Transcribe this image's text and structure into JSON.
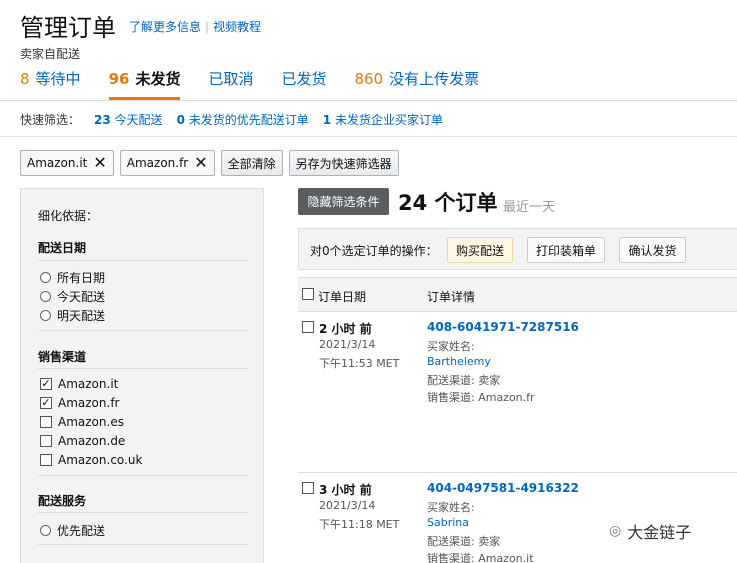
{
  "header": {
    "title": "管理订单",
    "link_learn": "了解更多信息",
    "link_video": "视频教程",
    "subtitle": "卖家自配送"
  },
  "tabs": [
    {
      "count": "8",
      "label": "等待中",
      "active": false
    },
    {
      "count": "96",
      "label": "未发货",
      "active": true
    },
    {
      "count": "",
      "label": "已取消",
      "active": false
    },
    {
      "count": "",
      "label": "已发货",
      "active": false
    },
    {
      "count": "860",
      "label": "没有上传发票",
      "active": false
    }
  ],
  "quick_filter": {
    "label": "快速筛选：",
    "items": [
      {
        "count": "23",
        "text": "今天配送"
      },
      {
        "count": "0",
        "text": "未发货的优先配送订单"
      },
      {
        "count": "1",
        "text": "未发货企业买家订单"
      }
    ]
  },
  "chips": {
    "chip1": "Amazon.it",
    "chip2": "Amazon.fr",
    "clear_all": "全部清除",
    "save_filter": "另存为快速筛选器"
  },
  "sidebar": {
    "refine_label": "细化依据：",
    "ship_date_title": "配送日期",
    "ship_date_options": [
      "所有日期",
      "今天配送",
      "明天配送"
    ],
    "channel_title": "销售渠道",
    "channels": [
      {
        "label": "Amazon.it",
        "checked": true
      },
      {
        "label": "Amazon.fr",
        "checked": true
      },
      {
        "label": "Amazon.es",
        "checked": false
      },
      {
        "label": "Amazon.de",
        "checked": false
      },
      {
        "label": "Amazon.co.uk",
        "checked": false
      }
    ],
    "service_title": "配送服务",
    "service_options": [
      "优先配送"
    ]
  },
  "main": {
    "hide_filter_btn": "隐藏筛选条件",
    "order_count": "24 个订单",
    "recent": "最近一天",
    "actions_label": "对0个选定订单的操作：",
    "action_buy": "购买配送",
    "action_print": "打印装箱单",
    "action_confirm": "确认发货",
    "col_date": "订单日期",
    "col_details": "订单详情"
  },
  "orders": [
    {
      "ago": "2 小时 前",
      "date": "2021/3/14",
      "time": "下午11:53 MET",
      "id": "408-6041971-7287516",
      "buyer_label": "买家姓名:",
      "buyer": "Barthelemy",
      "ship_channel": "配送渠道: 卖家",
      "sales_channel": "销售渠道: Amazon.fr"
    },
    {
      "ago": "3 小时 前",
      "date": "2021/3/14",
      "time": "下午11:18 MET",
      "id": "404-0497581-4916322",
      "buyer_label": "买家姓名:",
      "buyer": "Sabrina",
      "ship_channel": "配送渠道: 卖家",
      "sales_channel": "销售渠道: Amazon.it"
    }
  ],
  "watermark": {
    "icon": "wechat-icon",
    "text": "大金链子"
  }
}
